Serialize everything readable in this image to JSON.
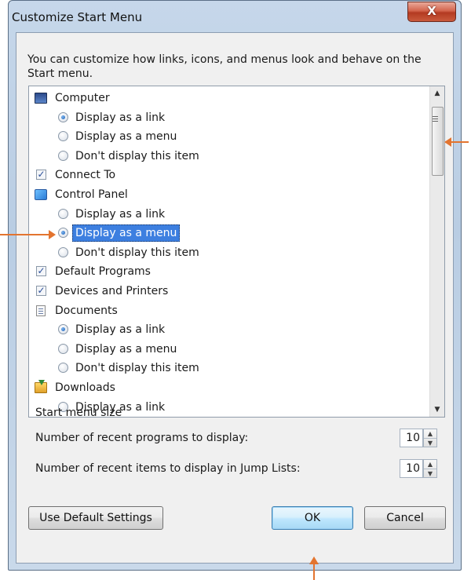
{
  "window": {
    "title": "Customize Start Menu",
    "close_glyph": "X"
  },
  "description": "You can customize how links, icons, and menus look and behave on the Start menu.",
  "tree": [
    {
      "kind": "folder",
      "icon": "computer-icon",
      "label": "Computer"
    },
    {
      "kind": "radio",
      "label": "Display as a link",
      "selected": true
    },
    {
      "kind": "radio",
      "label": "Display as a menu",
      "selected": false
    },
    {
      "kind": "radio",
      "label": "Don't display this item",
      "selected": false
    },
    {
      "kind": "check",
      "label": "Connect To",
      "checked": true
    },
    {
      "kind": "folder",
      "icon": "control-panel-icon",
      "label": "Control Panel"
    },
    {
      "kind": "radio",
      "label": "Display as a link",
      "selected": false
    },
    {
      "kind": "radio",
      "label": "Display as a menu",
      "selected": true,
      "highlighted": true
    },
    {
      "kind": "radio",
      "label": "Don't display this item",
      "selected": false
    },
    {
      "kind": "check",
      "label": "Default Programs",
      "checked": true
    },
    {
      "kind": "check",
      "label": "Devices and Printers",
      "checked": true
    },
    {
      "kind": "folder",
      "icon": "documents-icon",
      "label": "Documents"
    },
    {
      "kind": "radio",
      "label": "Display as a link",
      "selected": true
    },
    {
      "kind": "radio",
      "label": "Display as a menu",
      "selected": false
    },
    {
      "kind": "radio",
      "label": "Don't display this item",
      "selected": false
    },
    {
      "kind": "folder",
      "icon": "downloads-icon",
      "label": "Downloads"
    },
    {
      "kind": "radio",
      "label": "Display as a link",
      "selected": false
    }
  ],
  "start_menu_size": {
    "group_label": "Start menu size",
    "recent_programs_label": "Number of recent programs to display:",
    "recent_programs_value": "10",
    "jump_list_label": "Number of recent items to display in Jump Lists:",
    "jump_list_value": "10"
  },
  "buttons": {
    "defaults": "Use Default Settings",
    "ok": "OK",
    "cancel": "Cancel"
  },
  "colors": {
    "annotation_arrow": "#e3742f",
    "selection": "#3d7fe0"
  }
}
